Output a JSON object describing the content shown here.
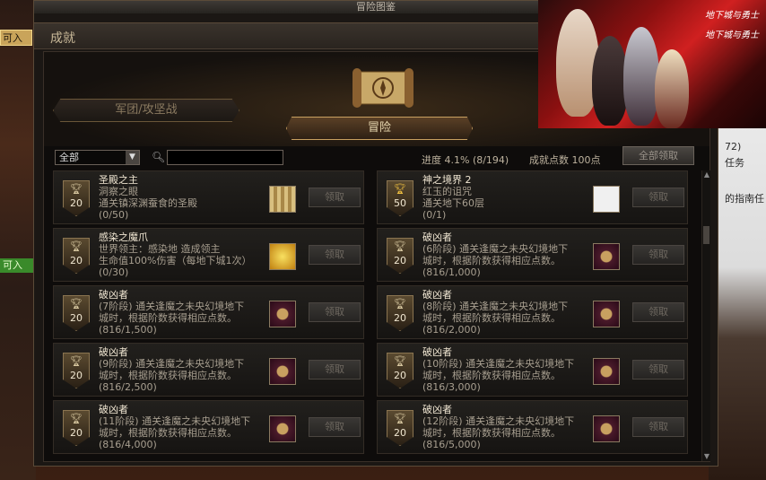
{
  "window": {
    "title": "冒险图鉴",
    "section_title": "成就"
  },
  "tabs": {
    "left": "军团/攻坚战",
    "center": "冒险"
  },
  "filter": {
    "selected": "全部",
    "search_placeholder": ""
  },
  "stats": {
    "progress": "进度  4.1% (8/194)",
    "points": "成就点数 100点",
    "claim_all": "全部领取"
  },
  "achievements": [
    {
      "title": "圣殿之主",
      "desc": "洞察之眼\n通关镇深渊蚕食的圣殿",
      "progress": "(0/50)",
      "points": "20",
      "cup": "silver",
      "claim": "领取",
      "icon": "map-icon"
    },
    {
      "title": "神之境界 2",
      "desc": "红玉的诅咒\n通关地下60层",
      "progress": "(0/1)",
      "points": "50",
      "cup": "gold",
      "claim": "领取",
      "icon": "scroll-doc-icon"
    },
    {
      "title": "感染之魔爪",
      "desc": "世界领主：感染地      造成领主\n生命值100%伤害（每地下城1次）",
      "progress": "(0/30)",
      "points": "20",
      "cup": "silver",
      "claim": "领取",
      "icon": "gold-claw-icon"
    },
    {
      "title": "破凶者",
      "desc": "(6阶段) 通关逢魔之未央幻境地下\n城时，根据阶数获得相应点数。",
      "progress": "(816/1,000)",
      "points": "20",
      "cup": "silver",
      "claim": "领取",
      "icon": "emblem-icon"
    },
    {
      "title": "破凶者",
      "desc": "(7阶段) 通关逢魔之未央幻境地下\n城时，根据阶数获得相应点数。",
      "progress": "(816/1,500)",
      "points": "20",
      "cup": "silver",
      "claim": "领取",
      "icon": "emblem-icon"
    },
    {
      "title": "破凶者",
      "desc": "(8阶段) 通关逢魔之未央幻境地下\n城时，根据阶数获得相应点数。",
      "progress": "(816/2,000)",
      "points": "20",
      "cup": "silver",
      "claim": "领取",
      "icon": "emblem-icon"
    },
    {
      "title": "破凶者",
      "desc": "(9阶段) 通关逢魔之未央幻境地下\n城时，根据阶数获得相应点数。",
      "progress": "(816/2,500)",
      "points": "20",
      "cup": "silver",
      "claim": "领取",
      "icon": "emblem-icon"
    },
    {
      "title": "破凶者",
      "desc": "(10阶段) 通关逢魔之未央幻境地下\n城时，根据阶数获得相应点数。",
      "progress": "(816/3,000)",
      "points": "20",
      "cup": "silver",
      "claim": "领取",
      "icon": "emblem-icon"
    },
    {
      "title": "破凶者",
      "desc": "(11阶段) 通关逢魔之未央幻境地下\n城时，根据阶数获得相应点数。",
      "progress": "(816/4,000)",
      "points": "20",
      "cup": "silver",
      "claim": "领取",
      "icon": "emblem-icon"
    },
    {
      "title": "破凶者",
      "desc": "(12阶段) 通关逢魔之未央幻境地下\n城时，根据阶数获得相应点数。",
      "progress": "(816/5,000)",
      "points": "20",
      "cup": "silver",
      "claim": "领取",
      "icon": "emblem-icon"
    }
  ],
  "side": {
    "left_button": "可入",
    "left_green": "可入",
    "right_lines": [
      "72)",
      "任务",
      "的指南任"
    ]
  },
  "promo": {
    "logo1": "地下城与勇士",
    "logo2": "地下城与勇士"
  }
}
